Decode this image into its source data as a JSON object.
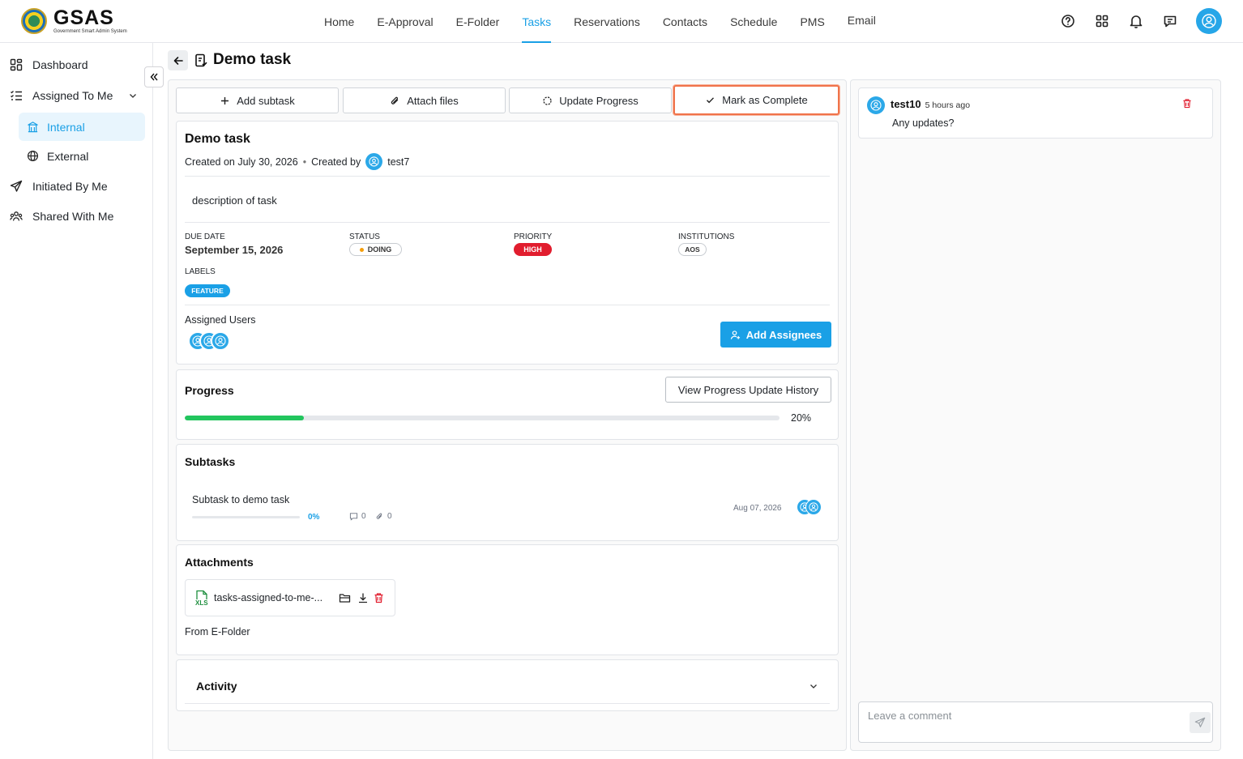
{
  "app": {
    "logo_text": "GSAS",
    "logo_subtitle": "Government Smart Admin System"
  },
  "nav": {
    "items": [
      "Home",
      "E-Approval",
      "E-Folder",
      "Tasks",
      "Reservations",
      "Contacts",
      "Schedule",
      "PMS",
      "Email"
    ],
    "active": "Tasks"
  },
  "header_icons": [
    "help-icon",
    "apps-grid-icon",
    "bell-icon",
    "message-icon",
    "user-avatar-icon"
  ],
  "sidebar": {
    "dashboard": "Dashboard",
    "assigned_to_me": "Assigned To Me",
    "internal": "Internal",
    "external": "External",
    "initiated_by_me": "Initiated By Me",
    "shared_with_me": "Shared With Me"
  },
  "page": {
    "title": "Demo task"
  },
  "actions": {
    "add_subtask": "Add subtask",
    "attach_files": "Attach files",
    "update_progress": "Update Progress",
    "mark_complete": "Mark as Complete"
  },
  "task": {
    "name": "Demo task",
    "created_on": "Created on July 30, 2026",
    "separator": "•",
    "created_by_label": "Created by",
    "creator": "test7",
    "description": "description of task",
    "due_date_label": "DUE DATE",
    "due_date": "September 15, 2026",
    "status_label": "STATUS",
    "status": "DOING",
    "priority_label": "PRIORITY",
    "priority": "HIGH",
    "institutions_label": "INSTITUTIONS",
    "institution": "AOS",
    "labels_label": "LABELS",
    "label": "FEATURE",
    "assigned_users_label": "Assigned Users",
    "assigned_count": 3,
    "add_assignees": "Add Assignees"
  },
  "progress": {
    "title": "Progress",
    "history_button": "View Progress Update History",
    "value": 0.2,
    "value_text": "20%"
  },
  "subtasks": {
    "title": "Subtasks",
    "items": [
      {
        "name": "Subtask to demo task",
        "progress": 0,
        "progress_text": "0%",
        "comments": "0",
        "attachments": "0",
        "date": "Aug 07, 2026",
        "assignees": 2
      }
    ]
  },
  "attachments": {
    "title": "Attachments",
    "file_name": "tasks-assigned-to-me-...",
    "file_type": "XLS",
    "from_efolder": "From E-Folder"
  },
  "activity": {
    "title": "Activity"
  },
  "comments": {
    "items": [
      {
        "author": "test10",
        "time": "5 hours ago",
        "text": "Any updates?"
      }
    ],
    "placeholder": "Leave a comment"
  },
  "colors": {
    "accent": "#1aa0e6",
    "progress": "#22c55e",
    "priority_high": "#e11d2e",
    "status_dot": "#f59e0b",
    "highlight": "#f0734a",
    "delete": "#e11d2e",
    "xls": "#1e8e3e"
  }
}
